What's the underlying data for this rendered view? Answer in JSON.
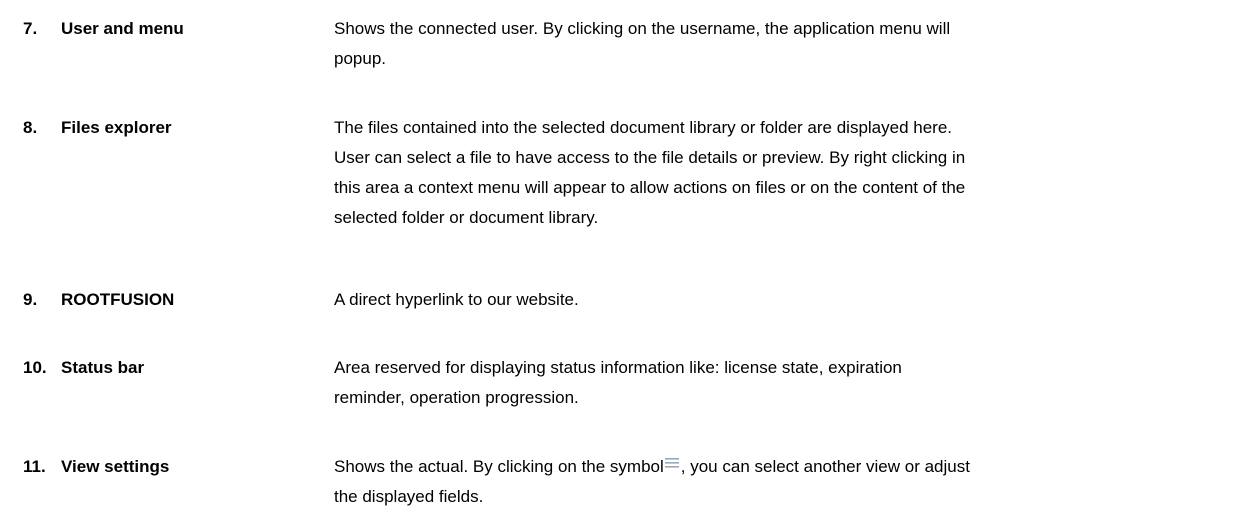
{
  "entries": [
    {
      "number": "7.",
      "term": "User and menu",
      "lines": [
        "Shows the connected user. By clicking on the username, the application menu will",
        "popup."
      ]
    },
    {
      "number": "8.",
      "term": "Files explorer",
      "lines": [
        "The files contained into the selected document library or folder are displayed here.",
        "User can select a file to have access to the file details or preview. By right clicking in",
        "this area a context menu will appear to allow actions on files or on the content of the",
        "selected folder or document library."
      ]
    },
    {
      "number": "9.",
      "term": "ROOTFUSION",
      "lines": [
        "A direct hyperlink to our website."
      ]
    },
    {
      "number": "10.",
      "term": "Status bar",
      "lines": [
        "Area reserved for displaying status information like: license state, expiration",
        "reminder, operation progression."
      ]
    },
    {
      "number": "11.",
      "term": "View settings",
      "line1_before_icon": "Shows the actual. By clicking on the symbol",
      "icon": "menu-lines-icon",
      "line1_after_icon": ", you can select another view or adjust",
      "line2": "the displayed fields."
    }
  ]
}
